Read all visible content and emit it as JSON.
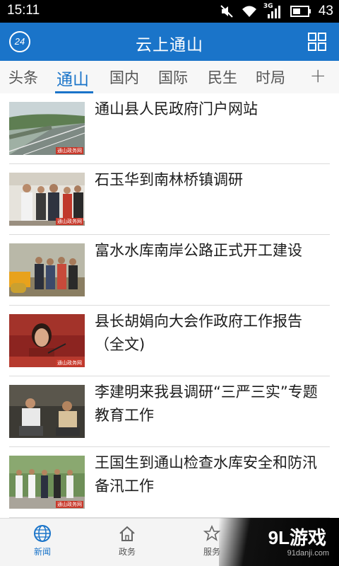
{
  "status": {
    "time": "15:11",
    "network": "3G",
    "battery": "43"
  },
  "header": {
    "badge": "24",
    "title": "云上通山"
  },
  "tabs": [
    {
      "label": "头条",
      "active": false
    },
    {
      "label": "通山",
      "active": true
    },
    {
      "label": "国内",
      "active": false
    },
    {
      "label": "国际",
      "active": false
    },
    {
      "label": "民生",
      "active": false
    },
    {
      "label": "时局",
      "active": false
    }
  ],
  "tab_add_label": "+",
  "news": [
    {
      "title": "通山县人民政府门户网站",
      "thumb_tag": "通山政务网"
    },
    {
      "title": "石玉华到南林桥镇调研",
      "thumb_tag": "通山政务网"
    },
    {
      "title": "富水水库南岸公路正式开工建设",
      "thumb_tag": ""
    },
    {
      "title": "县长胡娟向大会作政府工作报告（全文)",
      "thumb_tag": "通山政务网"
    },
    {
      "title": "李建明来我县调研“三严三实”专题教育工作",
      "thumb_tag": ""
    },
    {
      "title": "王国生到通山检查水库安全和防汛备汛工作",
      "thumb_tag": "通山政务网"
    }
  ],
  "bottom_nav": [
    {
      "label": "新闻",
      "icon": "globe-icon",
      "active": true
    },
    {
      "label": "政务",
      "icon": "house-icon",
      "active": false
    },
    {
      "label": "服务",
      "icon": "star-icon",
      "active": false
    }
  ],
  "watermark": {
    "main": "9L游戏",
    "sub": "91danji.com"
  },
  "colors": {
    "accent": "#1a74c9",
    "status_bar": "#000000"
  }
}
